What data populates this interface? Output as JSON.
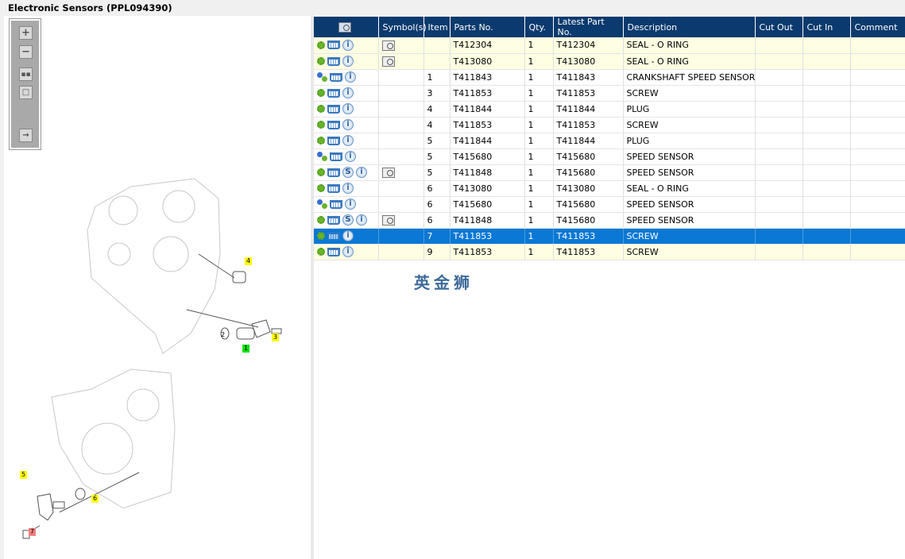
{
  "title": "Electronic Sensors (PPL094390)",
  "toolbar": {
    "items": [
      "zoom-in",
      "zoom-out",
      "fit-all",
      "actual-size",
      "export"
    ]
  },
  "diagram": {
    "callouts": [
      "4",
      "2",
      "1",
      "3",
      "5",
      "6",
      "7"
    ]
  },
  "watermark": "英金狮",
  "table": {
    "headers": [
      "",
      "Symbol(s)",
      "Item",
      "Parts No.",
      "Qty.",
      "Latest Part No.",
      "Description",
      "Cut Out",
      "Cut In",
      "Comment"
    ],
    "rows": [
      {
        "gear": "single",
        "s": false,
        "book": true,
        "item": "",
        "part": "T412304",
        "qty": "1",
        "latest": "T412304",
        "desc": "SEAL - O RING",
        "style": "yellow"
      },
      {
        "gear": "single",
        "s": false,
        "book": true,
        "item": "",
        "part": "T413080",
        "qty": "1",
        "latest": "T413080",
        "desc": "SEAL - O RING",
        "style": "yellow"
      },
      {
        "gear": "multi",
        "s": false,
        "book": false,
        "item": "1",
        "part": "T411843",
        "qty": "1",
        "latest": "T411843",
        "desc": "CRANKSHAFT SPEED SENSOR",
        "style": ""
      },
      {
        "gear": "single",
        "s": false,
        "book": false,
        "item": "3",
        "part": "T411853",
        "qty": "1",
        "latest": "T411853",
        "desc": "SCREW",
        "style": ""
      },
      {
        "gear": "single",
        "s": false,
        "book": false,
        "item": "4",
        "part": "T411844",
        "qty": "1",
        "latest": "T411844",
        "desc": "PLUG",
        "style": ""
      },
      {
        "gear": "single",
        "s": false,
        "book": false,
        "item": "4",
        "part": "T411853",
        "qty": "1",
        "latest": "T411853",
        "desc": "SCREW",
        "style": ""
      },
      {
        "gear": "single",
        "s": false,
        "book": false,
        "item": "5",
        "part": "T411844",
        "qty": "1",
        "latest": "T411844",
        "desc": "PLUG",
        "style": ""
      },
      {
        "gear": "multi",
        "s": false,
        "book": false,
        "item": "5",
        "part": "T415680",
        "qty": "1",
        "latest": "T415680",
        "desc": "SPEED SENSOR",
        "style": ""
      },
      {
        "gear": "single",
        "s": true,
        "book": true,
        "item": "5",
        "part": "T411848",
        "qty": "1",
        "latest": "T415680",
        "desc": "SPEED SENSOR",
        "style": ""
      },
      {
        "gear": "single",
        "s": false,
        "book": false,
        "item": "6",
        "part": "T413080",
        "qty": "1",
        "latest": "T413080",
        "desc": "SEAL - O RING",
        "style": ""
      },
      {
        "gear": "multi",
        "s": false,
        "book": false,
        "item": "6",
        "part": "T415680",
        "qty": "1",
        "latest": "T415680",
        "desc": "SPEED SENSOR",
        "style": ""
      },
      {
        "gear": "single",
        "s": true,
        "book": true,
        "item": "6",
        "part": "T411848",
        "qty": "1",
        "latest": "T415680",
        "desc": "SPEED SENSOR",
        "style": ""
      },
      {
        "gear": "single",
        "s": false,
        "book": false,
        "item": "7",
        "part": "T411853",
        "qty": "1",
        "latest": "T411853",
        "desc": "SCREW",
        "style": "selected"
      },
      {
        "gear": "single",
        "s": false,
        "book": false,
        "item": "9",
        "part": "T411853",
        "qty": "1",
        "latest": "T411853",
        "desc": "SCREW",
        "style": "yellow"
      }
    ]
  },
  "icons": {
    "s_badge": "S",
    "info": "i"
  }
}
